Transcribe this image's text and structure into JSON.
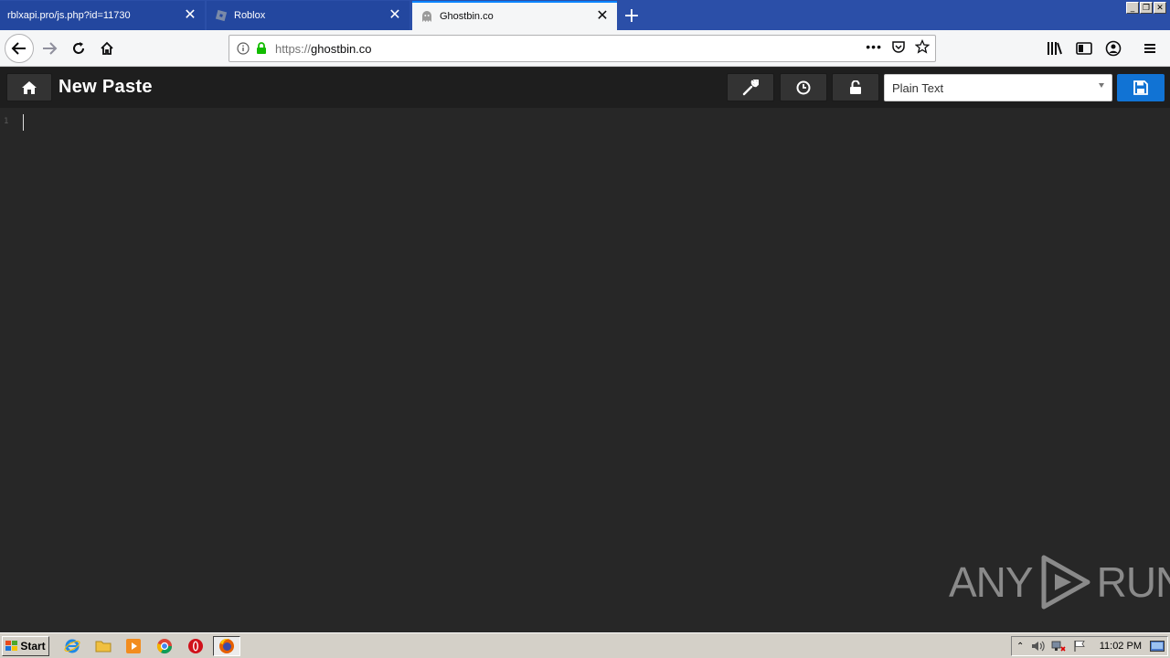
{
  "browser": {
    "tabs": [
      {
        "title": "rblxapi.pro/js.php?id=11730",
        "active": false,
        "icon": "none"
      },
      {
        "title": "Roblox",
        "active": false,
        "icon": "roblox-icon"
      },
      {
        "title": "Ghostbin.co",
        "active": true,
        "icon": "ghost-icon"
      }
    ],
    "url_protocol": "https://",
    "url_host": "ghostbin.co"
  },
  "page": {
    "title": "New Paste",
    "language_selected": "Plain Text",
    "line_numbers": [
      "1"
    ],
    "accent_color": "#1173d4"
  },
  "watermark": {
    "left": "ANY",
    "right": "RUN"
  },
  "taskbar": {
    "start_label": "Start",
    "clock": "11:02 PM"
  }
}
